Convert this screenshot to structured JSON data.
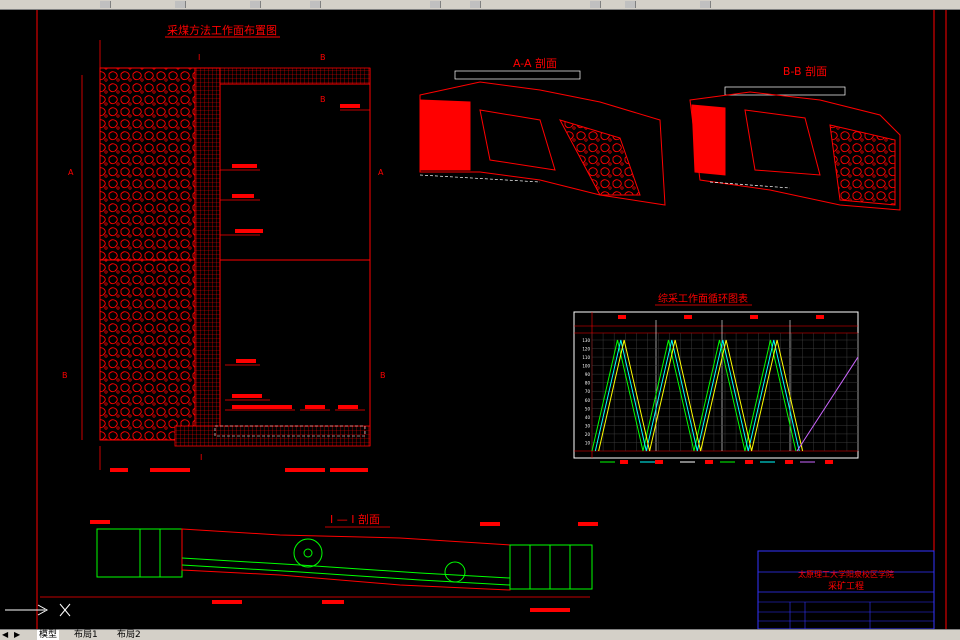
{
  "tabs": {
    "model": "模型",
    "layout1": "布局1",
    "layout2": "布局2"
  },
  "drawing": {
    "main_title": "采煤方法工作面布置图",
    "section_aa": "A-A 剖面",
    "section_bb": "B-B 剖面",
    "section_ii": "I — I 剖面",
    "cycle_title": "综采工作面循环图表",
    "university": "太原理工大学阳泉校区学院",
    "program": "采矿工程",
    "markers": {
      "A": "A",
      "B": "B",
      "I": "I"
    }
  },
  "colors": {
    "line": "#ff0000",
    "green": "#00ff00",
    "cyan": "#00ffff",
    "yellow": "#ffff00",
    "magenta": "#cc66ff",
    "blue": "#3333ff",
    "white": "#ffffff"
  },
  "chart_data": {
    "type": "line",
    "title": "综采工作面循环图表",
    "x_range": [
      0,
      24
    ],
    "y_range": [
      0,
      130
    ],
    "y_ticks": [
      130,
      120,
      110,
      100,
      90,
      80,
      70,
      60,
      50,
      40,
      30,
      20,
      10
    ],
    "series": [
      {
        "color": "#00ff00",
        "x": [
          0,
          2.3,
          4.6,
          6.9,
          9.2,
          11.5,
          13.8,
          16.1,
          18.4
        ],
        "y": [
          0,
          130,
          0,
          130,
          0,
          130,
          0,
          130,
          0
        ]
      },
      {
        "color": "#00ffff",
        "x": [
          0.3,
          2.6,
          4.9,
          7.2,
          9.5,
          11.8,
          14.1,
          16.4,
          18.7
        ],
        "y": [
          0,
          130,
          0,
          130,
          0,
          130,
          0,
          130,
          0
        ]
      },
      {
        "color": "#ffff00",
        "x": [
          0.6,
          2.9,
          5.2,
          7.5,
          9.8,
          12.1,
          14.4,
          16.7,
          19.0
        ],
        "y": [
          0,
          130,
          0,
          130,
          0,
          130,
          0,
          130,
          0
        ]
      },
      {
        "color": "#cc66ff",
        "x": [
          18.5,
          24
        ],
        "y": [
          0,
          110
        ]
      }
    ]
  }
}
